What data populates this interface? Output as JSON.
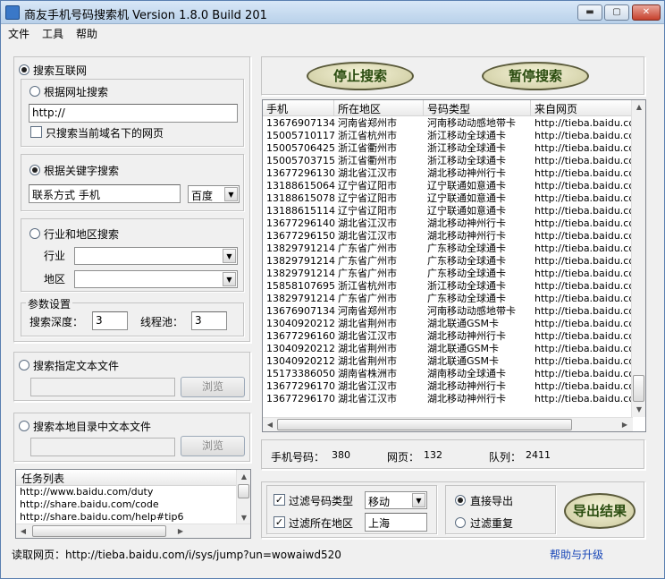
{
  "window": {
    "title": "商友手机号码搜索机 Version 1.8.0 Build 201",
    "minimize": "▬",
    "maximize": "▢",
    "close": "✕"
  },
  "menu": [
    "文件",
    "工具",
    "帮助"
  ],
  "left": {
    "search_web": "搜索互联网",
    "by_url": "根据网址搜索",
    "url_value": "http://",
    "only_domain": "只搜索当前域名下的网页",
    "by_keyword": "根据关键字搜索",
    "keyword_value": "联系方式 手机",
    "engine": "百度",
    "by_industry": "行业和地区搜索",
    "industry_label": "行业",
    "region_label": "地区",
    "params_title": "参数设置",
    "depth_label": "搜索深度：",
    "depth_value": "3",
    "threads_label": "线程池：",
    "threads_value": "3",
    "search_file": "搜索指定文本文件",
    "browse1": "浏览",
    "search_dir": "搜索本地目录中文本文件",
    "browse2": "浏览",
    "task_header": "任务列表",
    "tasks": [
      "http://www.baidu.com/duty",
      "http://share.baidu.com/code",
      "http://share.baidu.com/help#tip6"
    ]
  },
  "buttons": {
    "stop": "停止搜索",
    "pause": "暂停搜索",
    "export": "导出结果"
  },
  "table": {
    "headers": [
      "手机",
      "所在地区",
      "号码类型",
      "来自网页"
    ],
    "rows": [
      [
        "13676907134",
        "河南省郑州市",
        "河南移动动感地带卡",
        "http://tieba.baidu.com"
      ],
      [
        "15005710117",
        "浙江省杭州市",
        "浙江移动全球通卡",
        "http://tieba.baidu.com"
      ],
      [
        "15005706425",
        "浙江省衢州市",
        "浙江移动全球通卡",
        "http://tieba.baidu.com"
      ],
      [
        "15005703715",
        "浙江省衢州市",
        "浙江移动全球通卡",
        "http://tieba.baidu.com"
      ],
      [
        "13677296130",
        "湖北省江汉市",
        "湖北移动神州行卡",
        "http://tieba.baidu.com"
      ],
      [
        "13188615064",
        "辽宁省辽阳市",
        "辽宁联通如意通卡",
        "http://tieba.baidu.com"
      ],
      [
        "13188615078",
        "辽宁省辽阳市",
        "辽宁联通如意通卡",
        "http://tieba.baidu.com"
      ],
      [
        "13188615114",
        "辽宁省辽阳市",
        "辽宁联通如意通卡",
        "http://tieba.baidu.com"
      ],
      [
        "13677296140",
        "湖北省江汉市",
        "湖北移动神州行卡",
        "http://tieba.baidu.com"
      ],
      [
        "13677296150",
        "湖北省江汉市",
        "湖北移动神州行卡",
        "http://tieba.baidu.com"
      ],
      [
        "13829791214",
        "广东省广州市",
        "广东移动全球通卡",
        "http://tieba.baidu.com"
      ],
      [
        "13829791214",
        "广东省广州市",
        "广东移动全球通卡",
        "http://tieba.baidu.com"
      ],
      [
        "13829791214",
        "广东省广州市",
        "广东移动全球通卡",
        "http://tieba.baidu.com"
      ],
      [
        "15858107695",
        "浙江省杭州市",
        "浙江移动全球通卡",
        "http://tieba.baidu.com"
      ],
      [
        "13829791214",
        "广东省广州市",
        "广东移动全球通卡",
        "http://tieba.baidu.com"
      ],
      [
        "13676907134",
        "河南省郑州市",
        "河南移动动感地带卡",
        "http://tieba.baidu.com"
      ],
      [
        "13040920212",
        "湖北省荆州市",
        "湖北联通GSM卡",
        "http://tieba.baidu.com"
      ],
      [
        "13677296160",
        "湖北省江汉市",
        "湖北移动神州行卡",
        "http://tieba.baidu.com"
      ],
      [
        "13040920212",
        "湖北省荆州市",
        "湖北联通GSM卡",
        "http://tieba.baidu.com"
      ],
      [
        "13040920212",
        "湖北省荆州市",
        "湖北联通GSM卡",
        "http://tieba.baidu.com"
      ],
      [
        "15173386050",
        "湖南省株洲市",
        "湖南移动全球通卡",
        "http://tieba.baidu.com"
      ],
      [
        "13677296170",
        "湖北省江汉市",
        "湖北移动神州行卡",
        "http://tieba.baidu.com"
      ],
      [
        "13677296170",
        "湖北省江汉市",
        "湖北移动神州行卡",
        "http://tieba.baidu.com"
      ]
    ]
  },
  "stats": {
    "phone_label": "手机号码：",
    "phone_value": "380",
    "page_label": "网页：",
    "page_value": "132",
    "queue_label": "队列：",
    "queue_value": "2411"
  },
  "filter": {
    "type_label": "过滤号码类型",
    "type_value": "移动",
    "region_label": "过滤所在地区",
    "region_value": "上海",
    "direct_export": "直接导出",
    "filter_dup": "过滤重复"
  },
  "status": {
    "reading": "读取网页：http://tieba.baidu.com/i/sys/jump?un=wowaiwd520",
    "help": "帮助与升级"
  }
}
